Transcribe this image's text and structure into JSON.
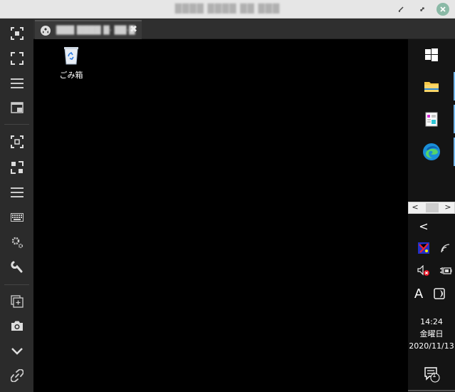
{
  "window": {
    "title": "████ ████ ██ ███"
  },
  "tab": {
    "label": "███ ████ █· ██·█"
  },
  "left_toolbar": {
    "items": [
      "focus-icon",
      "fullscreen-icon",
      "menu-icon",
      "window-icon",
      "scale-icon",
      "shrink-icon",
      "list-icon",
      "keyboard-icon",
      "settings-icon",
      "wrench-icon",
      "add-window-icon",
      "camera-icon",
      "chevron-down-icon",
      "disconnect-icon"
    ]
  },
  "desktop": {
    "recycle_bin_label": "ごみ箱"
  },
  "taskbar": {
    "scroll_left": "<",
    "scroll_right": ">",
    "tray_chevron": "<",
    "ime_label": "A",
    "clock_time": "14:24",
    "clock_day": "金曜日",
    "clock_date": "2020/11/13",
    "notification_count": "1",
    "accent_color": "#76b9ed"
  }
}
